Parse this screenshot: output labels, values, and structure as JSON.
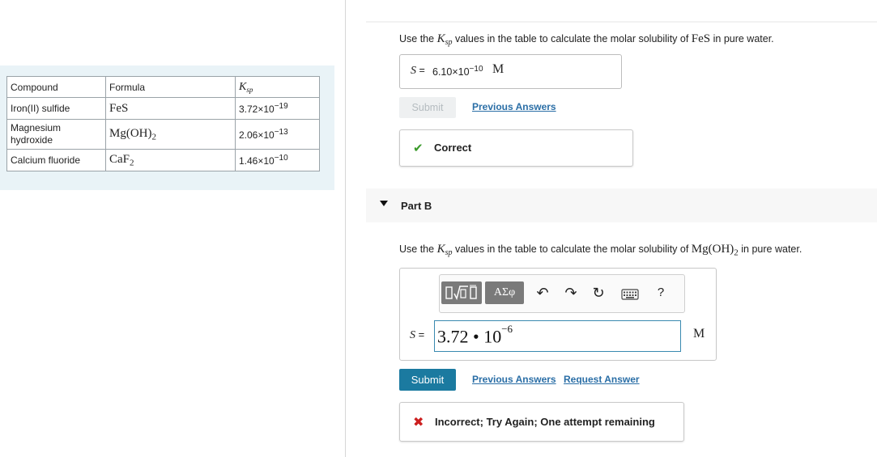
{
  "table": {
    "headers": {
      "compound": "Compound",
      "formula": "Formula",
      "ksp": "K",
      "ksp_sub": "sp"
    },
    "rows": [
      {
        "compound": "Iron(II) sulfide",
        "formula_base": "FeS",
        "formula_sub": "",
        "formula_base2": "",
        "ksp_mantissa": "3.72×10",
        "ksp_exp": "−19"
      },
      {
        "compound": "Magnesium hydroxide",
        "formula_base": "Mg(OH)",
        "formula_sub": "2",
        "formula_base2": "",
        "ksp_mantissa": "2.06×10",
        "ksp_exp": "−13"
      },
      {
        "compound": "Calcium fluoride",
        "formula_base": "CaF",
        "formula_sub": "2",
        "formula_base2": "",
        "ksp_mantissa": "1.46×10",
        "ksp_exp": "−10"
      }
    ]
  },
  "partA": {
    "question_pre": "Use the ",
    "question_k": "K",
    "question_ksub": "sp",
    "question_mid": " values in the table to calculate the molar solubility of ",
    "question_compound": "FeS",
    "question_post": " in pure water.",
    "answer_label": "S",
    "answer_eq": " = ",
    "answer_mantissa": "6.10×10",
    "answer_exp": "−10",
    "answer_unit": "M",
    "submit_label": "Submit",
    "previous_answers": "Previous Answers",
    "feedback": "Correct"
  },
  "partB": {
    "title": "Part B",
    "question_pre": "Use the ",
    "question_k": "K",
    "question_ksub": "sp",
    "question_mid": " values in the table to calculate the molar solubility of ",
    "question_compound": "Mg(OH)",
    "question_compound_sub": "2",
    "question_post": " in pure water.",
    "toolbar": {
      "greek_label": "ΑΣφ",
      "help_label": "?"
    },
    "input_label": "S",
    "input_eq": " = ",
    "input_base": "3.72 • 10",
    "input_exp": "−6",
    "unit": "M",
    "submit_label": "Submit",
    "previous_answers": "Previous Answers",
    "request_answer": "Request Answer",
    "feedback": "Incorrect; Try Again; One attempt remaining"
  },
  "colors": {
    "table_panel_bg": "#e9f3f7",
    "submit_blue": "#1b7aa0",
    "link_blue": "#2a6ea6",
    "correct_green": "#3a9a2a",
    "incorrect_red": "#cc1f1f"
  }
}
